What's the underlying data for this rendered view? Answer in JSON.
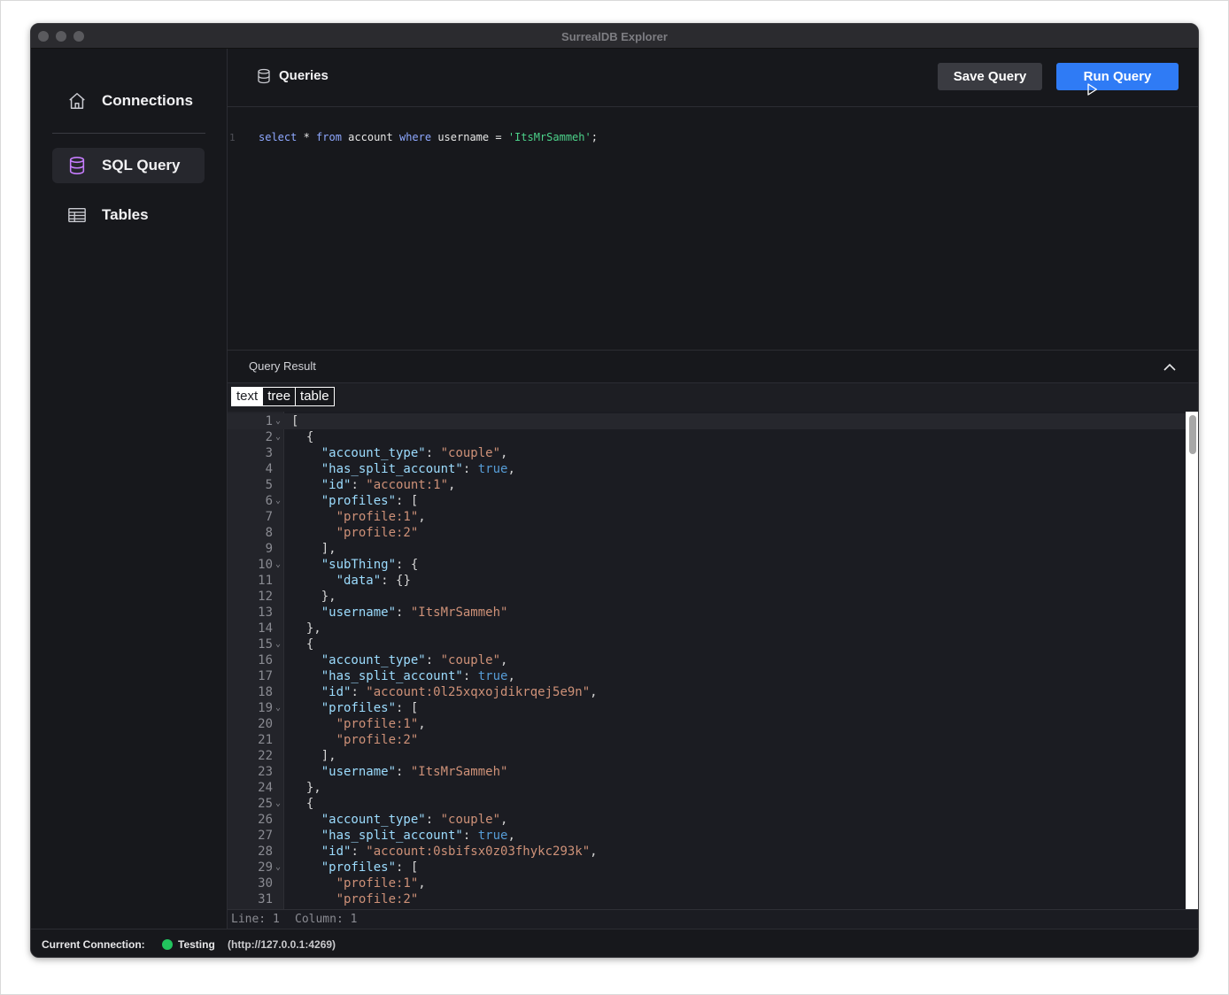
{
  "window": {
    "title": "SurrealDB Explorer"
  },
  "sidebar": {
    "items": [
      {
        "label": "Connections",
        "icon": "home-icon"
      },
      {
        "label": "SQL Query",
        "icon": "database-icon"
      },
      {
        "label": "Tables",
        "icon": "table-icon"
      }
    ]
  },
  "queries": {
    "title": "Queries",
    "save_label": "Save Query",
    "run_label": "Run Query"
  },
  "editor": {
    "line_number": "1",
    "tokens": {
      "t1": "select",
      "t2": " * ",
      "t3": "from",
      "t4": " account ",
      "t5": "where",
      "t6": " username = ",
      "t7": "'ItsMrSammeh'",
      "t8": ";"
    }
  },
  "result": {
    "title": "Query Result",
    "modes": [
      "text",
      "tree",
      "table"
    ],
    "active_mode": "text"
  },
  "json_lines": [
    {
      "n": "1",
      "fold": true,
      "parts": [
        [
          "p",
          "["
        ]
      ]
    },
    {
      "n": "2",
      "fold": true,
      "parts": [
        [
          "p",
          "  {"
        ]
      ]
    },
    {
      "n": "3",
      "parts": [
        [
          "p",
          "    "
        ],
        [
          "k",
          "\"account_type\""
        ],
        [
          "p",
          ": "
        ],
        [
          "s",
          "\"couple\""
        ],
        [
          "p",
          ","
        ]
      ]
    },
    {
      "n": "4",
      "parts": [
        [
          "p",
          "    "
        ],
        [
          "k",
          "\"has_split_account\""
        ],
        [
          "p",
          ": "
        ],
        [
          "b",
          "true"
        ],
        [
          "p",
          ","
        ]
      ]
    },
    {
      "n": "5",
      "parts": [
        [
          "p",
          "    "
        ],
        [
          "k",
          "\"id\""
        ],
        [
          "p",
          ": "
        ],
        [
          "s",
          "\"account:1\""
        ],
        [
          "p",
          ","
        ]
      ]
    },
    {
      "n": "6",
      "fold": true,
      "parts": [
        [
          "p",
          "    "
        ],
        [
          "k",
          "\"profiles\""
        ],
        [
          "p",
          ": ["
        ]
      ]
    },
    {
      "n": "7",
      "parts": [
        [
          "p",
          "      "
        ],
        [
          "s",
          "\"profile:1\""
        ],
        [
          "p",
          ","
        ]
      ]
    },
    {
      "n": "8",
      "parts": [
        [
          "p",
          "      "
        ],
        [
          "s",
          "\"profile:2\""
        ]
      ]
    },
    {
      "n": "9",
      "parts": [
        [
          "p",
          "    ],"
        ]
      ]
    },
    {
      "n": "10",
      "fold": true,
      "parts": [
        [
          "p",
          "    "
        ],
        [
          "k",
          "\"subThing\""
        ],
        [
          "p",
          ": {"
        ]
      ]
    },
    {
      "n": "11",
      "parts": [
        [
          "p",
          "      "
        ],
        [
          "k",
          "\"data\""
        ],
        [
          "p",
          ": {}"
        ]
      ]
    },
    {
      "n": "12",
      "parts": [
        [
          "p",
          "    },"
        ]
      ]
    },
    {
      "n": "13",
      "parts": [
        [
          "p",
          "    "
        ],
        [
          "k",
          "\"username\""
        ],
        [
          "p",
          ": "
        ],
        [
          "s",
          "\"ItsMrSammeh\""
        ]
      ]
    },
    {
      "n": "14",
      "parts": [
        [
          "p",
          "  },"
        ]
      ]
    },
    {
      "n": "15",
      "fold": true,
      "parts": [
        [
          "p",
          "  {"
        ]
      ]
    },
    {
      "n": "16",
      "parts": [
        [
          "p",
          "    "
        ],
        [
          "k",
          "\"account_type\""
        ],
        [
          "p",
          ": "
        ],
        [
          "s",
          "\"couple\""
        ],
        [
          "p",
          ","
        ]
      ]
    },
    {
      "n": "17",
      "parts": [
        [
          "p",
          "    "
        ],
        [
          "k",
          "\"has_split_account\""
        ],
        [
          "p",
          ": "
        ],
        [
          "b",
          "true"
        ],
        [
          "p",
          ","
        ]
      ]
    },
    {
      "n": "18",
      "parts": [
        [
          "p",
          "    "
        ],
        [
          "k",
          "\"id\""
        ],
        [
          "p",
          ": "
        ],
        [
          "s",
          "\"account:0l25xqxojdikrqej5e9n\""
        ],
        [
          "p",
          ","
        ]
      ]
    },
    {
      "n": "19",
      "fold": true,
      "parts": [
        [
          "p",
          "    "
        ],
        [
          "k",
          "\"profiles\""
        ],
        [
          "p",
          ": ["
        ]
      ]
    },
    {
      "n": "20",
      "parts": [
        [
          "p",
          "      "
        ],
        [
          "s",
          "\"profile:1\""
        ],
        [
          "p",
          ","
        ]
      ]
    },
    {
      "n": "21",
      "parts": [
        [
          "p",
          "      "
        ],
        [
          "s",
          "\"profile:2\""
        ]
      ]
    },
    {
      "n": "22",
      "parts": [
        [
          "p",
          "    ],"
        ]
      ]
    },
    {
      "n": "23",
      "parts": [
        [
          "p",
          "    "
        ],
        [
          "k",
          "\"username\""
        ],
        [
          "p",
          ": "
        ],
        [
          "s",
          "\"ItsMrSammeh\""
        ]
      ]
    },
    {
      "n": "24",
      "parts": [
        [
          "p",
          "  },"
        ]
      ]
    },
    {
      "n": "25",
      "fold": true,
      "parts": [
        [
          "p",
          "  {"
        ]
      ]
    },
    {
      "n": "26",
      "parts": [
        [
          "p",
          "    "
        ],
        [
          "k",
          "\"account_type\""
        ],
        [
          "p",
          ": "
        ],
        [
          "s",
          "\"couple\""
        ],
        [
          "p",
          ","
        ]
      ]
    },
    {
      "n": "27",
      "parts": [
        [
          "p",
          "    "
        ],
        [
          "k",
          "\"has_split_account\""
        ],
        [
          "p",
          ": "
        ],
        [
          "b",
          "true"
        ],
        [
          "p",
          ","
        ]
      ]
    },
    {
      "n": "28",
      "parts": [
        [
          "p",
          "    "
        ],
        [
          "k",
          "\"id\""
        ],
        [
          "p",
          ": "
        ],
        [
          "s",
          "\"account:0sbifsx0z03fhykc293k\""
        ],
        [
          "p",
          ","
        ]
      ]
    },
    {
      "n": "29",
      "fold": true,
      "parts": [
        [
          "p",
          "    "
        ],
        [
          "k",
          "\"profiles\""
        ],
        [
          "p",
          ": ["
        ]
      ]
    },
    {
      "n": "30",
      "parts": [
        [
          "p",
          "      "
        ],
        [
          "s",
          "\"profile:1\""
        ],
        [
          "p",
          ","
        ]
      ]
    },
    {
      "n": "31",
      "parts": [
        [
          "p",
          "      "
        ],
        [
          "s",
          "\"profile:2\""
        ]
      ]
    }
  ],
  "cursor": {
    "line": "Line: 1",
    "column": "Column: 1"
  },
  "status": {
    "label": "Current Connection:",
    "name": "Testing",
    "url": "(http://127.0.0.1:4269)",
    "dot_color": "#22c55e"
  },
  "colors": {
    "accent": "#2f7bf5",
    "sql_query_icon": "#c77dff"
  }
}
